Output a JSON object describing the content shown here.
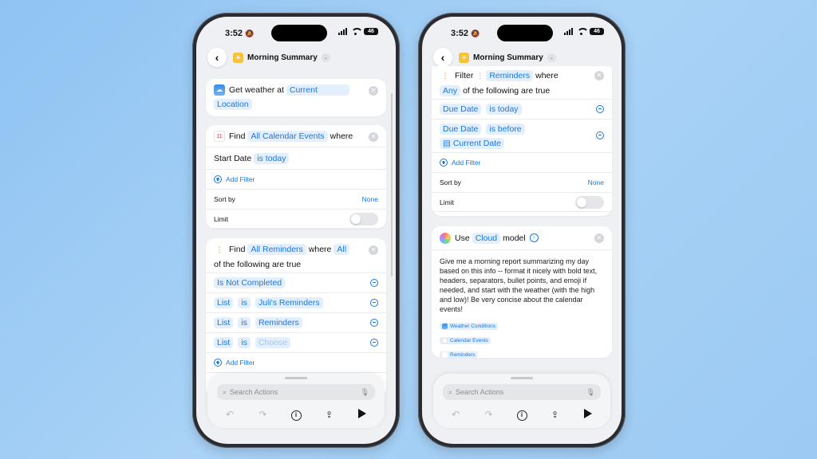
{
  "status": {
    "time": "3:52",
    "battery": "46"
  },
  "header": {
    "title": "Morning Summary"
  },
  "left": {
    "weather": {
      "prefix": "Get weather at",
      "location_line1": "Current",
      "location_line2": "Location"
    },
    "calendar": {
      "find": "Find",
      "source": "All Calendar Events",
      "where": "where",
      "filter_field": "Start Date",
      "filter_value": "is today",
      "add_filter": "Add Filter",
      "sort_label": "Sort by",
      "sort_value": "None",
      "limit_label": "Limit"
    },
    "reminders": {
      "find": "Find",
      "source": "All Reminders",
      "where": "where",
      "any": "All",
      "tail": "of the following are true",
      "filters": [
        {
          "field": "Is Not Completed"
        },
        {
          "field": "List",
          "op": "is",
          "value": "Juli's Reminders"
        },
        {
          "field": "List",
          "op": "is",
          "value": "Reminders"
        },
        {
          "field": "List",
          "op": "is",
          "value": "Choose"
        }
      ],
      "add_filter": "Add Filter"
    }
  },
  "right": {
    "filter": {
      "label": "Filter",
      "source": "Reminders",
      "where": "where",
      "any": "Any",
      "tail": "of the following are true",
      "row1_field": "Due Date",
      "row1_op": "is today",
      "row2_field": "Due Date",
      "row2_op": "is before",
      "row2_value": "Current Date",
      "add_filter": "Add Filter",
      "sort_label": "Sort by",
      "sort_value": "None",
      "limit_label": "Limit"
    },
    "model": {
      "use": "Use",
      "model_name": "Cloud",
      "model_word": "model",
      "prompt": "Give me a morning report summarizing my day based on this info -- format it nicely with bold text, headers, separators, bullet points, and emoji if needed, and start with the weather (with the high and low)! Be very concise about the calendar events!",
      "variables": [
        "Weather Conditions",
        "Calendar Events",
        "Reminders"
      ]
    }
  },
  "bottom": {
    "search_placeholder": "Search Actions"
  }
}
